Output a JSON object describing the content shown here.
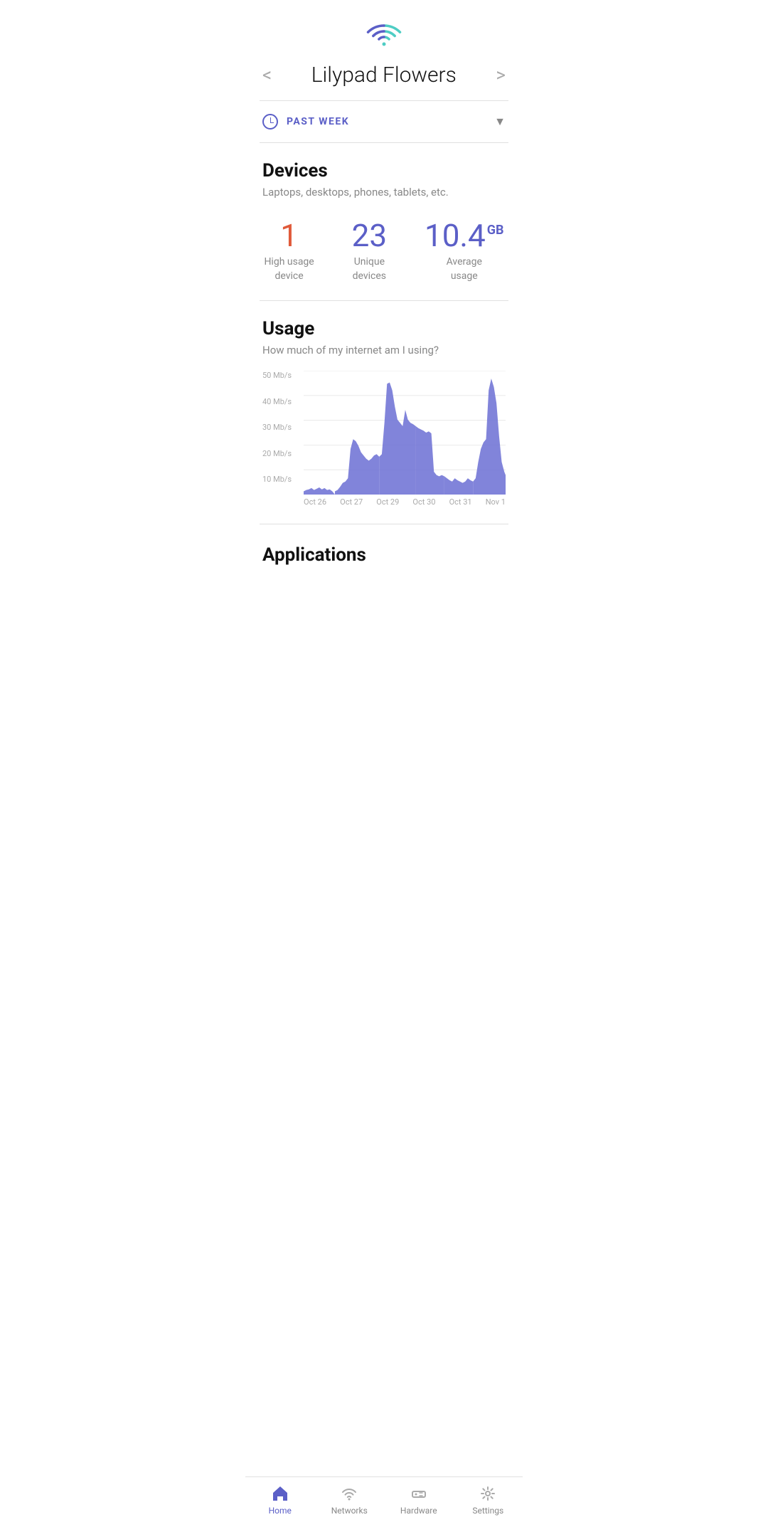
{
  "wifi_icon_label": "wifi",
  "header": {
    "title": "Lilypad Flowers",
    "prev_label": "<",
    "next_label": ">"
  },
  "time_filter": {
    "label": "PAST WEEK",
    "dropdown_icon": "▼"
  },
  "devices_section": {
    "title": "Devices",
    "subtitle": "Laptops, desktops, phones, tablets, etc.",
    "stats": [
      {
        "value": "1",
        "label": "High usage\ndevice",
        "color": "red"
      },
      {
        "value": "23",
        "label": "Unique\ndevices",
        "color": "purple"
      },
      {
        "value": "10.4",
        "unit": "GB",
        "label": "Average\nusage",
        "color": "purple-gb"
      }
    ]
  },
  "usage_section": {
    "title": "Usage",
    "subtitle": "How much of my internet am I using?",
    "y_labels": [
      "50 Mb/s",
      "40 Mb/s",
      "30 Mb/s",
      "20 Mb/s",
      "10 Mb/s"
    ],
    "x_labels": [
      "Oct 26",
      "Oct 27",
      "Oct 29",
      "Oct 30",
      "Oct 31",
      "Nov 1"
    ]
  },
  "applications_section": {
    "title": "Applications"
  },
  "bottom_nav": {
    "items": [
      {
        "id": "home",
        "label": "Home",
        "active": true
      },
      {
        "id": "networks",
        "label": "Networks",
        "active": false
      },
      {
        "id": "hardware",
        "label": "Hardware",
        "active": false
      },
      {
        "id": "settings",
        "label": "Settings",
        "active": false
      }
    ]
  }
}
